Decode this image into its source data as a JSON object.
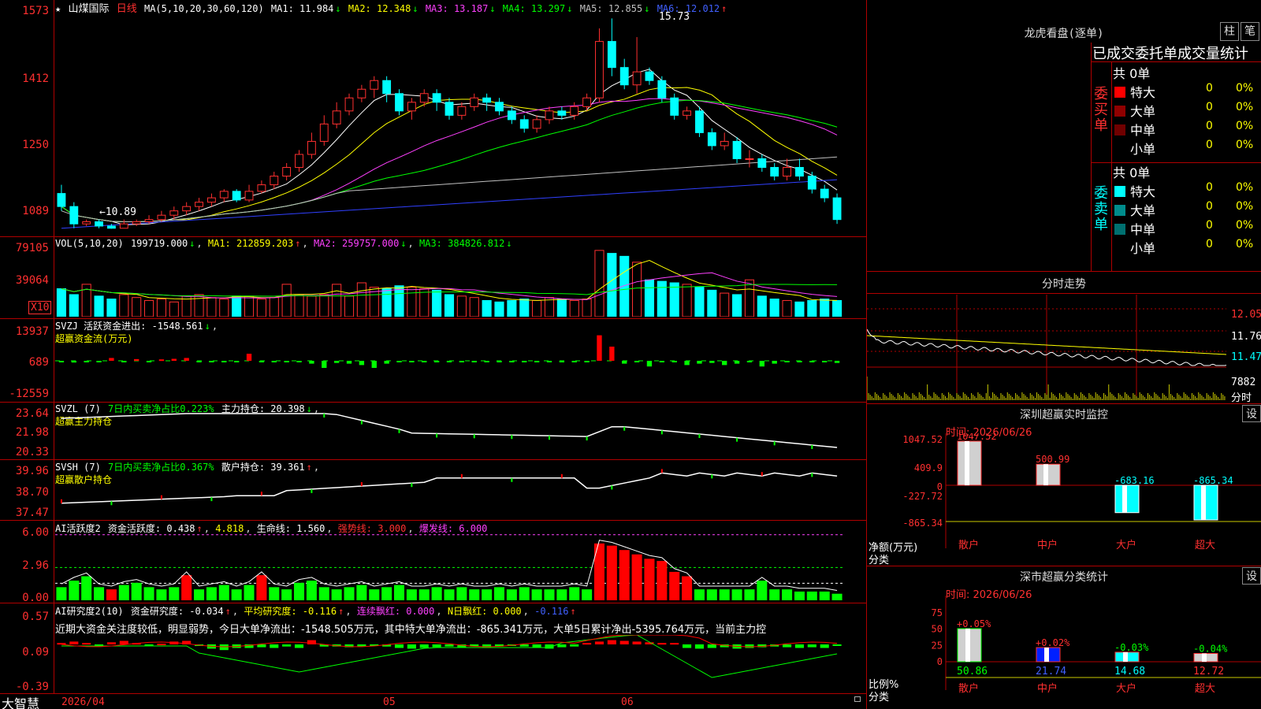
{
  "stock": {
    "star": "★",
    "title_icons": "★",
    "name": "山煤国际",
    "period": "日线"
  },
  "kline": {
    "ma_header": "MA(5,10,20,30,60,120)",
    "ma1": "MA1: 11.984",
    "ma1_arrow": "↓",
    "ma2": "MA2: 12.348",
    "ma2_arrow": "↓",
    "ma3": "MA3: 13.187",
    "ma3_arrow": "↓",
    "ma4": "MA4: 13.297",
    "ma4_arrow": "↓",
    "ma5": "MA5: 12.855",
    "ma5_arrow": "↓",
    "ma6": "MA6: 12.012",
    "ma6_arrow": "↑",
    "y_labels": [
      "1573",
      "1412",
      "1250",
      "1089"
    ],
    "high_marker": "15.73",
    "low_marker": "←10.89",
    "candles": [
      [
        11.7,
        11.4,
        11.9,
        11.3
      ],
      [
        11.4,
        11.0,
        11.5,
        10.9
      ],
      [
        11.0,
        11.05,
        11.1,
        10.95
      ],
      [
        11.05,
        10.95,
        11.1,
        10.9
      ],
      [
        10.95,
        10.9,
        11.0,
        10.89
      ],
      [
        10.9,
        11.0,
        11.1,
        10.9
      ],
      [
        11.0,
        11.05,
        11.1,
        10.95
      ],
      [
        11.05,
        11.1,
        11.2,
        11.0
      ],
      [
        11.1,
        11.2,
        11.3,
        11.05
      ],
      [
        11.2,
        11.3,
        11.4,
        11.1
      ],
      [
        11.3,
        11.4,
        11.5,
        11.2
      ],
      [
        11.4,
        11.5,
        11.6,
        11.3
      ],
      [
        11.5,
        11.6,
        11.7,
        11.4
      ],
      [
        11.6,
        11.75,
        11.8,
        11.5
      ],
      [
        11.75,
        11.55,
        11.8,
        11.5
      ],
      [
        11.55,
        11.75,
        11.9,
        11.5
      ],
      [
        11.75,
        11.9,
        12.0,
        11.7
      ],
      [
        11.9,
        12.1,
        12.2,
        11.8
      ],
      [
        12.1,
        12.3,
        12.4,
        12.0
      ],
      [
        12.3,
        12.6,
        12.7,
        12.2
      ],
      [
        12.6,
        12.9,
        13.1,
        12.5
      ],
      [
        12.9,
        13.3,
        13.5,
        12.8
      ],
      [
        13.3,
        13.6,
        13.8,
        13.2
      ],
      [
        13.6,
        13.9,
        14.0,
        13.5
      ],
      [
        13.9,
        14.1,
        14.2,
        13.8
      ],
      [
        14.1,
        14.3,
        14.4,
        13.9
      ],
      [
        14.3,
        14.0,
        14.4,
        13.8
      ],
      [
        14.0,
        13.6,
        14.1,
        13.5
      ],
      [
        13.6,
        13.8,
        13.9,
        13.4
      ],
      [
        13.8,
        14.0,
        14.1,
        13.7
      ],
      [
        14.0,
        13.8,
        14.1,
        13.6
      ],
      [
        13.8,
        13.5,
        13.9,
        13.4
      ],
      [
        13.5,
        13.7,
        13.8,
        13.4
      ],
      [
        13.7,
        13.9,
        14.0,
        13.6
      ],
      [
        13.9,
        13.8,
        14.0,
        13.6
      ],
      [
        13.8,
        13.6,
        13.9,
        13.5
      ],
      [
        13.6,
        13.4,
        13.7,
        13.3
      ],
      [
        13.4,
        13.2,
        13.5,
        13.1
      ],
      [
        13.2,
        13.4,
        13.5,
        13.1
      ],
      [
        13.4,
        13.6,
        13.7,
        13.3
      ],
      [
        13.6,
        13.5,
        13.7,
        13.4
      ],
      [
        13.5,
        13.7,
        13.8,
        13.4
      ],
      [
        13.7,
        13.9,
        14.0,
        13.6
      ],
      [
        13.9,
        15.2,
        15.5,
        13.8
      ],
      [
        15.2,
        14.6,
        15.73,
        14.4
      ],
      [
        14.6,
        14.2,
        14.8,
        14.1
      ],
      [
        14.2,
        14.5,
        15.3,
        14.0
      ],
      [
        14.5,
        14.3,
        14.6,
        14.2
      ],
      [
        14.3,
        13.9,
        14.4,
        13.8
      ],
      [
        13.9,
        13.5,
        14.0,
        13.4
      ],
      [
        13.5,
        13.6,
        13.7,
        13.4
      ],
      [
        13.6,
        13.1,
        13.7,
        13.0
      ],
      [
        13.1,
        12.8,
        13.2,
        12.7
      ],
      [
        12.8,
        12.9,
        13.1,
        12.7
      ],
      [
        12.9,
        12.5,
        13.0,
        12.4
      ],
      [
        12.5,
        12.5,
        12.7,
        12.3
      ],
      [
        12.5,
        12.3,
        12.6,
        12.2
      ],
      [
        12.3,
        12.1,
        12.4,
        12.0
      ],
      [
        12.1,
        12.3,
        12.5,
        12.0
      ],
      [
        12.3,
        12.1,
        12.5,
        12.0
      ],
      [
        12.1,
        11.8,
        12.2,
        11.7
      ],
      [
        11.8,
        11.6,
        11.9,
        11.5
      ],
      [
        11.6,
        11.1,
        11.7,
        11.0
      ]
    ]
  },
  "vol": {
    "header": "VOL(5,10,20)",
    "value": "199719.000",
    "value_arrow": "↓",
    "ma1": "MA1: 212859.203",
    "ma1_arrow": "↑",
    "ma2": "MA2: 259757.000",
    "ma2_arrow": "↓",
    "ma3": "MA3: 384826.812",
    "ma3_arrow": "↓",
    "y_labels": [
      "79105",
      "39064"
    ],
    "unit": "X10",
    "values": [
      38000,
      30000,
      44000,
      28000,
      24000,
      30000,
      26000,
      22000,
      24000,
      20000,
      28000,
      30000,
      26000,
      24000,
      28000,
      28000,
      24000,
      26000,
      44000,
      30000,
      28000,
      30000,
      44000,
      28000,
      46000,
      40000,
      38000,
      42000,
      40000,
      38000,
      36000,
      30000,
      28000,
      26000,
      22000,
      20000,
      22000,
      24000,
      22000,
      26000,
      24000,
      22000,
      24000,
      90000,
      86000,
      82000,
      74000,
      50000,
      48000,
      46000,
      44000,
      40000,
      36000,
      32000,
      30000,
      50000,
      28000,
      24000,
      22000,
      20000,
      22000,
      24000,
      22000
    ]
  },
  "svzj": {
    "line1": "SVZJ  活跃资金进出: -1548.561",
    "line1_arrow": "↓",
    "line2": "超赢资金流(万元)",
    "y_labels": [
      "13937",
      "689",
      "-12559"
    ],
    "values": [
      -100,
      -120,
      -80,
      -60,
      200,
      -60,
      120,
      -80,
      100,
      140,
      200,
      -40,
      -100,
      -60,
      -80,
      500,
      -80,
      -60,
      -100,
      -80,
      -200,
      -500,
      -150,
      -200,
      -300,
      -500,
      -200,
      -100,
      -100,
      -80,
      -80,
      -60,
      -80,
      -60,
      -100,
      -80,
      -60,
      -80,
      -60,
      -100,
      -80,
      -60,
      -100,
      1800,
      1000,
      -200,
      -100,
      -400,
      -80,
      -100,
      -300,
      -200,
      -150,
      -300,
      -200,
      -100,
      -400,
      -200,
      -100,
      -100,
      -100,
      -80,
      -150
    ]
  },
  "svzl": {
    "label": "SVZL (7)",
    "desc": "7日内买卖净占比0.223%",
    "hold": "主力持仓: 20.398",
    "hold_arrow": "↓",
    "line2": "超赢主力持仓",
    "y_labels": [
      "23.64",
      "21.98",
      "20.33"
    ]
  },
  "svsh": {
    "label": "SVSH (7)",
    "desc": "7日内买卖净占比0.367%",
    "hold": "散户持仓: 39.361",
    "hold_arrow": "↑",
    "line2": "超赢散户持仓",
    "y_labels": [
      "39.96",
      "38.70",
      "37.47"
    ]
  },
  "ai_active": {
    "label": "AI活跃度2",
    "v1": "资金活跃度: 0.438",
    "v1_arrow": "↑",
    "v2": "4.818",
    "v3": "生命线: 1.560",
    "v4": "强势线: 3.000",
    "v5": "爆发线: 6.000",
    "y_labels": [
      "6.00",
      "2.96",
      "0.00"
    ],
    "values": [
      1.2,
      1.8,
      2.2,
      1.2,
      1.0,
      1.4,
      1.6,
      1.2,
      1.0,
      1.2,
      2.3,
      1.0,
      1.2,
      1.4,
      1.0,
      1.4,
      2.3,
      1.2,
      1.0,
      1.6,
      1.8,
      1.2,
      1.0,
      1.2,
      1.4,
      1.0,
      1.2,
      1.4,
      1.0,
      1.0,
      1.2,
      1.0,
      1.2,
      1.0,
      1.0,
      1.2,
      1.0,
      1.2,
      1.0,
      1.0,
      1.0,
      1.2,
      1.0,
      5.2,
      5.0,
      4.6,
      4.2,
      3.8,
      3.6,
      2.6,
      2.2,
      1.0,
      1.0,
      1.0,
      1.0,
      1.0,
      1.8,
      1.0,
      1.0,
      0.8,
      0.8,
      0.8,
      0.6
    ],
    "red_flags": [
      0,
      0,
      0,
      0,
      1,
      0,
      0,
      0,
      0,
      0,
      1,
      0,
      0,
      0,
      0,
      0,
      1,
      0,
      0,
      0,
      0,
      0,
      0,
      0,
      0,
      0,
      0,
      0,
      0,
      0,
      0,
      0,
      0,
      0,
      0,
      0,
      0,
      0,
      0,
      0,
      0,
      0,
      0,
      1,
      1,
      1,
      1,
      1,
      1,
      1,
      1,
      0,
      0,
      0,
      0,
      0,
      0,
      0,
      0,
      0,
      0,
      0,
      0
    ]
  },
  "ai_research": {
    "label": "AI研究度2(10)",
    "v1": "资金研究度: -0.034",
    "v1_arrow": "↑",
    "v2": "平均研究度: -0.116",
    "v2_arrow": "↑",
    "v3": "连续飘红: 0.000",
    "v4": "N日飘红: 0.000",
    "v5": "-0.116",
    "v5_arrow": "↑",
    "note": "近期大资金关注度较低，明显弱势，今日大单净流出：-1548.505万元，其中特大单净流出：-865.341万元，大单5日累计净出-5395.764万元，当前主力控",
    "y_labels": [
      "0.57",
      "0.09",
      "-0.39"
    ],
    "values": [
      0.02,
      0.04,
      0.02,
      0.0,
      0.03,
      0.05,
      0.02,
      -0.02,
      0.01,
      0.04,
      0.05,
      -0.02,
      -0.06,
      -0.08,
      -0.05,
      -0.05,
      -0.04,
      -0.05,
      -0.03,
      -0.05,
      0.06,
      -0.03,
      -0.03,
      -0.04,
      -0.03,
      -0.02,
      -0.03,
      -0.05,
      -0.06,
      -0.05,
      -0.04,
      -0.03,
      -0.05,
      -0.03,
      -0.04,
      -0.03,
      -0.02,
      -0.03,
      -0.05,
      -0.06,
      -0.04,
      -0.03,
      0.02,
      0.04,
      0.06,
      0.05,
      0.04,
      0.03,
      0.02,
      0.02,
      -0.05,
      -0.06,
      -0.05,
      -0.04,
      -0.06,
      -0.05,
      -0.04,
      -0.03,
      -0.04,
      -0.05,
      -0.04,
      -0.05,
      -0.02
    ]
  },
  "bottom": {
    "brand": "大智慧",
    "date_start": "2026/04",
    "m05": "05",
    "m06": "06"
  },
  "dragon": {
    "title": "龙虎看盘(逐单)",
    "btn_bar": "柱",
    "btn_pen": "笔",
    "subtitle": "已成交委托单成交量统计",
    "buy_label": "委买单",
    "sell_label": "委卖单",
    "buy_total": "共 0单",
    "sell_total": "共 0单",
    "buy_rows": [
      {
        "name": "特大",
        "val": "0",
        "pct": "0%",
        "color": "#ff0000"
      },
      {
        "name": "大单",
        "val": "0",
        "pct": "0%",
        "color": "#900000"
      },
      {
        "name": "中单",
        "val": "0",
        "pct": "0%",
        "color": "#700000"
      },
      {
        "name": "小单",
        "val": "0",
        "pct": "0%",
        "color": "#000000"
      }
    ],
    "sell_rows": [
      {
        "name": "特大",
        "val": "0",
        "pct": "0%",
        "color": "#00ffff"
      },
      {
        "name": "大单",
        "val": "0",
        "pct": "0%",
        "color": "#008c8c"
      },
      {
        "name": "中单",
        "val": "0",
        "pct": "0%",
        "color": "#007070"
      },
      {
        "name": "小单",
        "val": "0",
        "pct": "0%",
        "color": "#000000"
      }
    ]
  },
  "intraday": {
    "title": "分时走势",
    "y_labels": [
      "12.05",
      "11.76",
      "11.47"
    ],
    "vol_label": "7882",
    "vol_unit": "分时"
  },
  "sz_monitor": {
    "title": "深圳超赢实时监控",
    "set": "设",
    "time": "时间: 2026/06/26",
    "y_labels": [
      "1047.52",
      "409.9",
      "0",
      "-227.72",
      "-865.34"
    ],
    "net_label": "净额(万元)",
    "cat_label": "分类",
    "cats": [
      "散户",
      "中户",
      "大户",
      "超大"
    ],
    "values": [
      "1047.52",
      "500.99",
      "-683.16",
      "-865.34"
    ],
    "nums": [
      1047.52,
      500.99,
      -683.16,
      -865.34
    ]
  },
  "sz_class": {
    "title": "深市超赢分类统计",
    "set": "设",
    "time": "时间: 2026/06/26",
    "y_labels": [
      "75",
      "50",
      "25",
      "0"
    ],
    "ratio_label": "比例%",
    "cat_label": "分类",
    "cats": [
      "散户",
      "中户",
      "大户",
      "超大"
    ],
    "changes": [
      "+0.05%",
      "+0.02%",
      "-0.03%",
      "-0.04%"
    ],
    "values": [
      "50.86",
      "21.74",
      "14.68",
      "12.72"
    ],
    "nums": [
      50.86,
      21.74,
      14.68,
      12.72
    ]
  },
  "colors": {
    "up": "#ff3030",
    "down": "#00ffff",
    "grid": "#b00000"
  }
}
